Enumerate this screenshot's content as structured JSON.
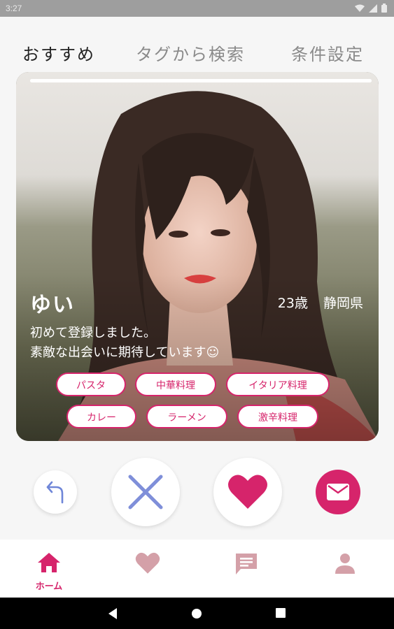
{
  "status_bar": {
    "time": "3:27"
  },
  "tabs": [
    {
      "label": "おすすめ",
      "active": true
    },
    {
      "label": "タグから検索",
      "active": false
    },
    {
      "label": "条件設定",
      "active": false
    }
  ],
  "profile": {
    "name": "ゆい",
    "age": "23歳",
    "location": "静岡県",
    "bio_line1": "初めて登録しました。",
    "bio_line2": "素敵な出会いに期待しています☺",
    "photo_progress": 1.0,
    "tags": [
      "パスタ",
      "中華料理",
      "イタリア料理",
      "カレー",
      "ラーメン",
      "激辛料理"
    ]
  },
  "actions": {
    "undo_icon": "undo-arrow-icon",
    "nope_icon": "close-x-icon",
    "like_icon": "heart-icon",
    "message_icon": "mail-icon"
  },
  "bottom_nav": [
    {
      "label": "ホーム",
      "icon": "home-icon",
      "active": true
    },
    {
      "label": "",
      "icon": "heart-icon",
      "active": false
    },
    {
      "label": "",
      "icon": "chat-icon",
      "active": false
    },
    {
      "label": "",
      "icon": "person-icon",
      "active": false
    }
  ],
  "colors": {
    "accent": "#d6246b",
    "inactive_icon": "#d4a0a8",
    "nope_icon": "#7f8fd9",
    "undo_icon": "#6f86d8"
  }
}
